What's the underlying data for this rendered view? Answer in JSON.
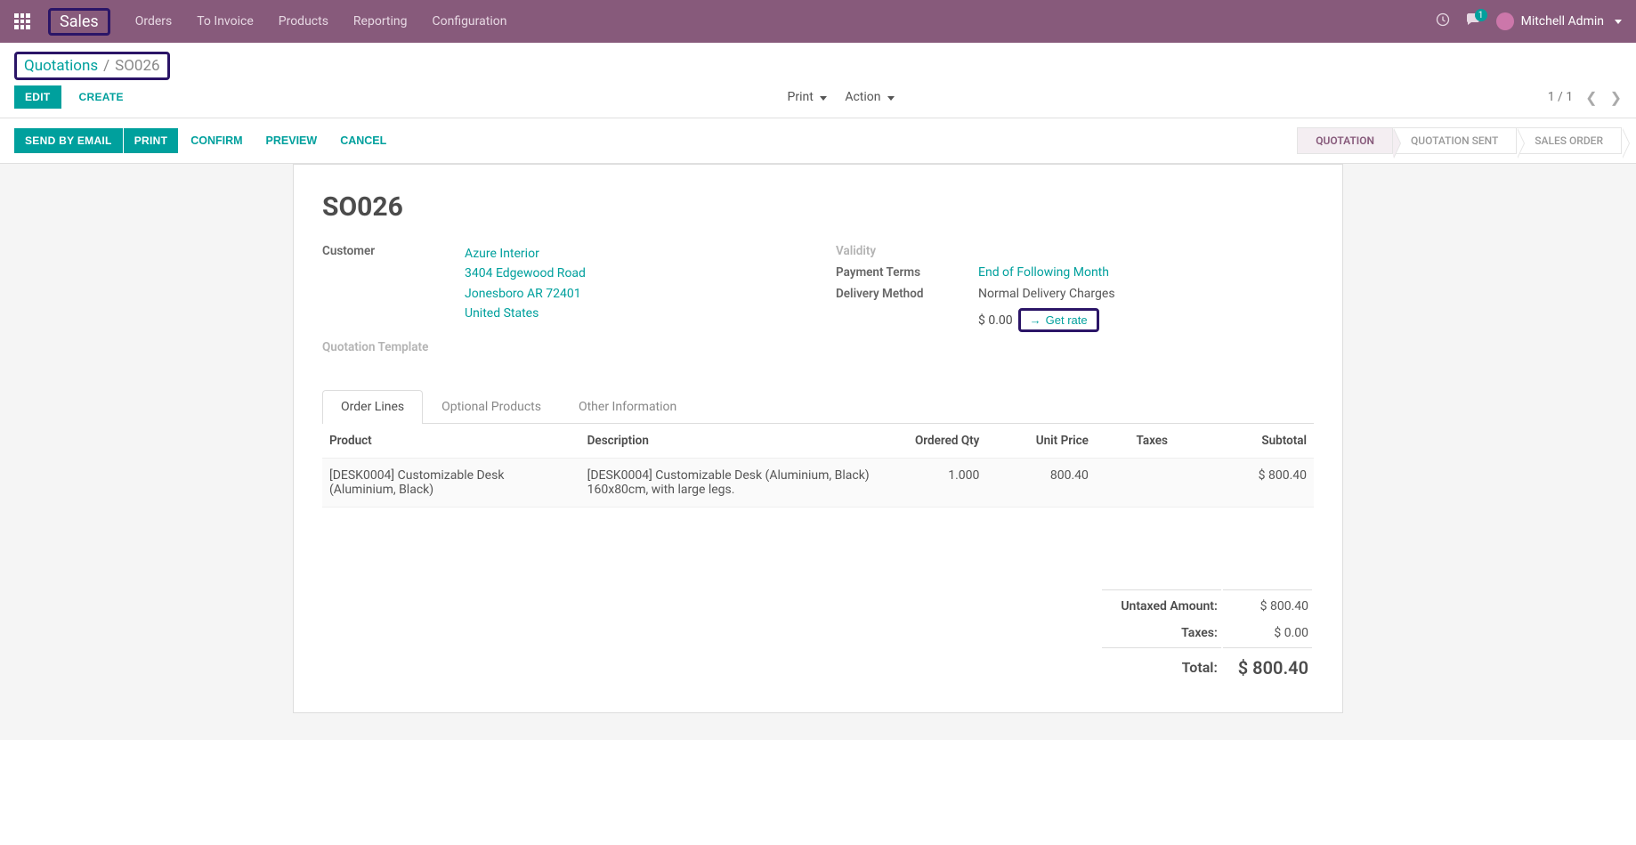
{
  "nav": {
    "brand": "Sales",
    "links": [
      "Orders",
      "To Invoice",
      "Products",
      "Reporting",
      "Configuration"
    ],
    "msg_count": "1",
    "user": "Mitchell Admin"
  },
  "breadcrumb": {
    "root": "Quotations",
    "current": "SO026"
  },
  "buttons": {
    "edit": "EDIT",
    "create": "CREATE",
    "print_dropdown": "Print",
    "action_dropdown": "Action",
    "pager": "1 / 1",
    "send_email": "SEND BY EMAIL",
    "print": "PRINT",
    "confirm": "CONFIRM",
    "preview": "PREVIEW",
    "cancel": "CANCEL",
    "get_rate": "Get rate"
  },
  "status_steps": [
    "QUOTATION",
    "QUOTATION SENT",
    "SALES ORDER"
  ],
  "record": {
    "title": "SO026",
    "labels": {
      "customer": "Customer",
      "quotation_template": "Quotation Template",
      "validity": "Validity",
      "payment_terms": "Payment Terms",
      "delivery_method": "Delivery Method"
    },
    "customer_name": "Azure Interior",
    "address_line1": "3404 Edgewood Road",
    "address_line2": "Jonesboro AR 72401",
    "address_line3": "United States",
    "payment_terms": "End of Following Month",
    "delivery_method": "Normal Delivery Charges",
    "delivery_rate": "$ 0.00"
  },
  "tabs": [
    "Order Lines",
    "Optional Products",
    "Other Information"
  ],
  "table": {
    "headers": {
      "product": "Product",
      "description": "Description",
      "qty": "Ordered Qty",
      "price": "Unit Price",
      "taxes": "Taxes",
      "subtotal": "Subtotal"
    },
    "rows": [
      {
        "product": "[DESK0004] Customizable Desk (Aluminium, Black)",
        "description": "[DESK0004] Customizable Desk (Aluminium, Black) 160x80cm, with large legs.",
        "qty": "1.000",
        "price": "800.40",
        "taxes": "",
        "subtotal": "$ 800.40"
      }
    ]
  },
  "totals": {
    "untaxed_label": "Untaxed Amount:",
    "untaxed_value": "$ 800.40",
    "taxes_label": "Taxes:",
    "taxes_value": "$ 0.00",
    "total_label": "Total:",
    "total_value": "$ 800.40"
  }
}
